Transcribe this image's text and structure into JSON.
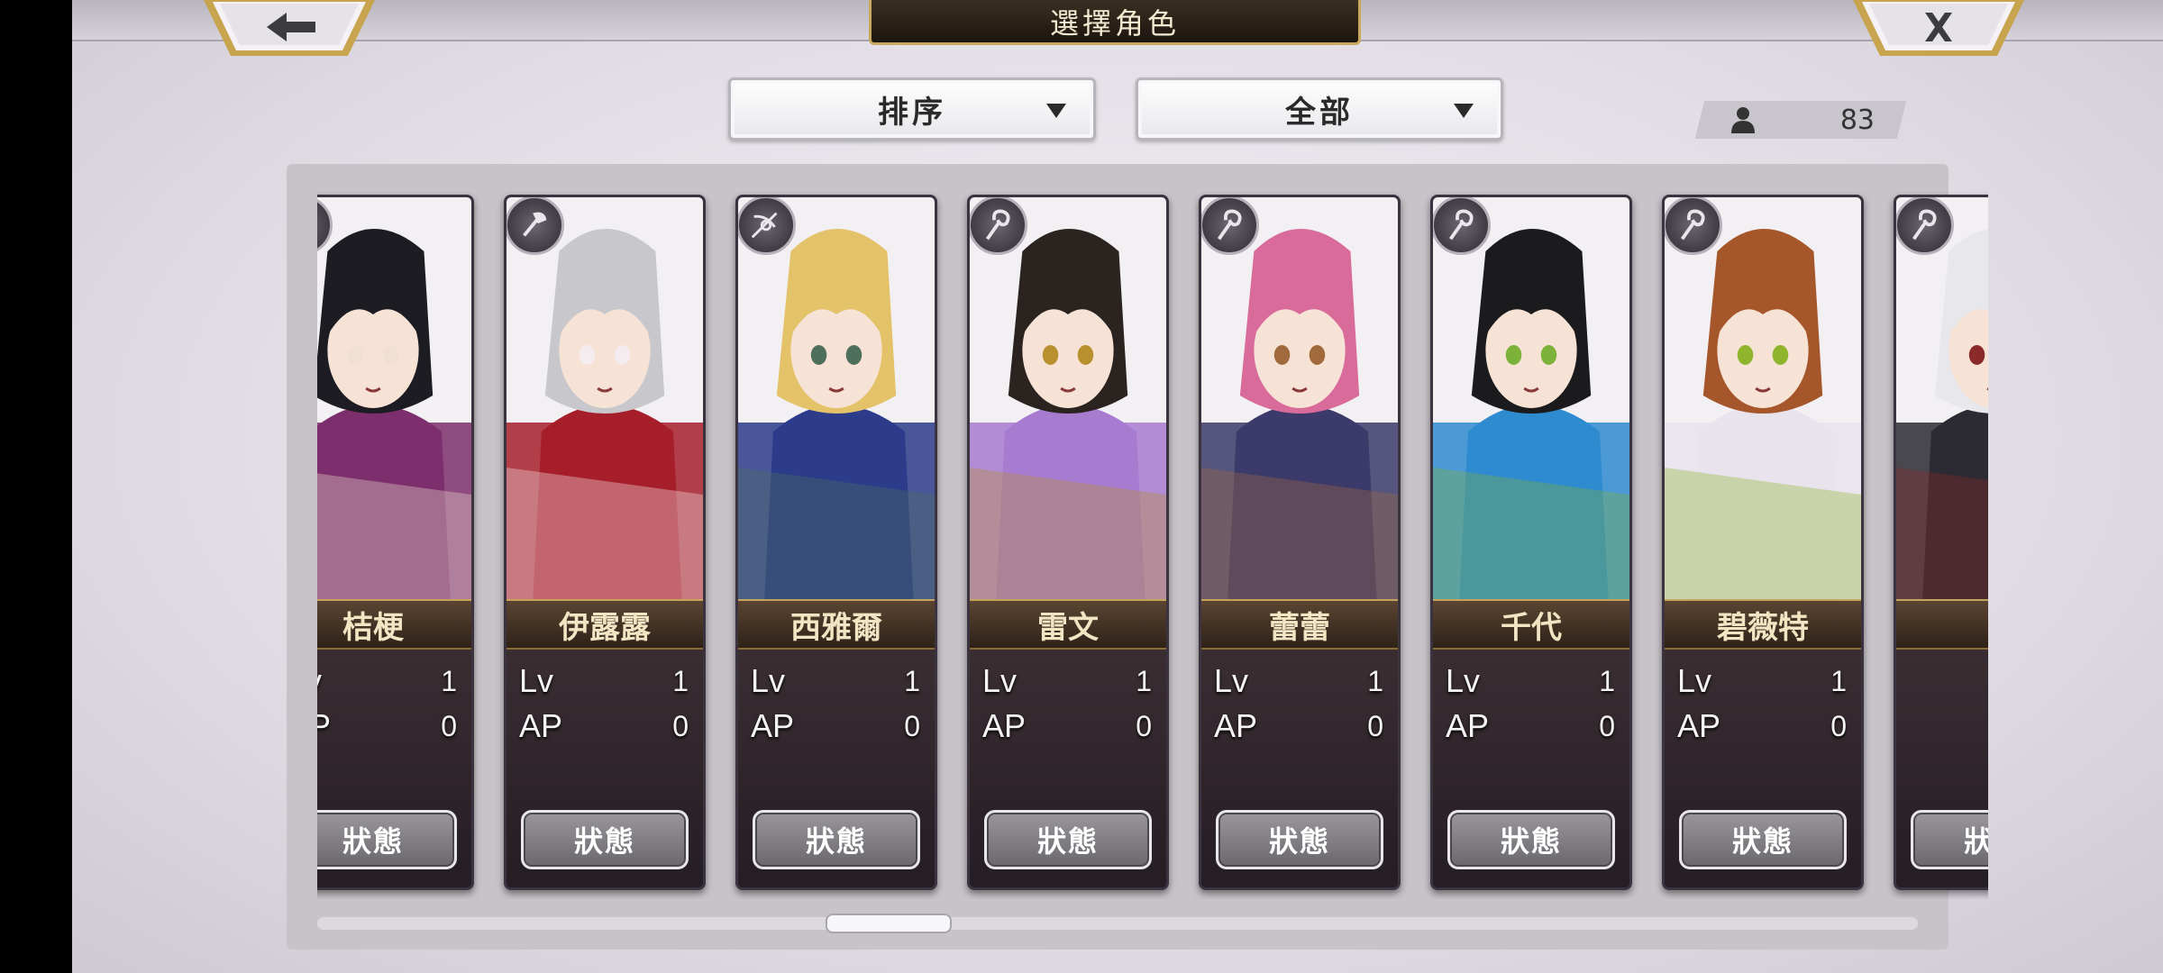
{
  "header": {
    "title": "選擇角色",
    "back_icon": "arrow-left-icon",
    "close_icon": "close-x-icon"
  },
  "filters": {
    "sort_label": "排序",
    "filter_label": "全部"
  },
  "character_count": "83",
  "stat_labels": {
    "lv": "Lv",
    "ap": "AP",
    "status_button": "狀態"
  },
  "cards": [
    {
      "name": "桔梗",
      "lv": "1",
      "ap": "0",
      "weapon_icon": "claw-icon",
      "colors": [
        "#1d1c22",
        "#7c2f6c",
        "#f1dfd2"
      ]
    },
    {
      "name": "伊露露",
      "lv": "1",
      "ap": "0",
      "weapon_icon": "axe-icon",
      "colors": [
        "#c8c8cc",
        "#a61e2a",
        "#f5ecef"
      ]
    },
    {
      "name": "西雅爾",
      "lv": "1",
      "ap": "0",
      "weapon_icon": "crossbow-icon",
      "colors": [
        "#e3c26a",
        "#2c3c8a",
        "#4e6f5c"
      ]
    },
    {
      "name": "雷文",
      "lv": "1",
      "ap": "0",
      "weapon_icon": "staff-icon",
      "colors": [
        "#2a2320",
        "#a77bd0",
        "#b8902e"
      ]
    },
    {
      "name": "蕾蕾",
      "lv": "1",
      "ap": "0",
      "weapon_icon": "staff-icon",
      "colors": [
        "#d96b9b",
        "#3b3a6a",
        "#a06a3c"
      ]
    },
    {
      "name": "千代",
      "lv": "1",
      "ap": "0",
      "weapon_icon": "staff-icon",
      "colors": [
        "#1b1a1d",
        "#2f8bd0",
        "#7db23a"
      ]
    },
    {
      "name": "碧薇特",
      "lv": "1",
      "ap": "0",
      "weapon_icon": "staff-icon",
      "colors": [
        "#a5562a",
        "#e9e3ee",
        "#8fb52c"
      ]
    },
    {
      "name": "",
      "lv": "",
      "ap": "",
      "weapon_icon": "staff-icon",
      "colors": [
        "#e8e8ec",
        "#2c2a32",
        "#8a2a2a"
      ]
    }
  ]
}
